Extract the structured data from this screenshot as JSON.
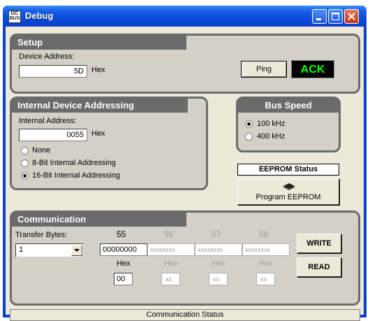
{
  "window": {
    "title": "Debug",
    "icon_text": "I2C BUS"
  },
  "setup": {
    "title": "Setup",
    "device_address_label": "Device Address:",
    "device_address_value": "5D",
    "hex_label": "Hex",
    "ping_label": "Ping",
    "ack_label": "ACK",
    "ack_color": "#00ff00"
  },
  "internal": {
    "title": "Internal Device Addressing",
    "address_label": "Internal Address:",
    "address_value": "0055",
    "hex_label": "Hex",
    "options": [
      "None",
      "8-Bit Internal Addressing",
      "16-Bit Internal Addressing"
    ],
    "selected": "16-Bit Internal Addressing"
  },
  "bus_speed": {
    "title": "Bus Speed",
    "options": [
      "100 kHz",
      "400 kHz"
    ],
    "selected": "100 kHz"
  },
  "eeprom": {
    "status_label": "EEPROM Status",
    "program_label": "Program EEPROM",
    "program_icon": "chip-icon"
  },
  "communication": {
    "title": "Communication",
    "transfer_bytes_label": "Transfer Bytes:",
    "transfer_bytes_value": "1",
    "columns": [
      {
        "number": "55",
        "binary": "00000000",
        "hex_label": "Hex",
        "hex": "00",
        "enabled": true
      },
      {
        "number": "56",
        "binary": "xxxxxxxx",
        "hex_label": "Hex",
        "hex": "xx",
        "enabled": false
      },
      {
        "number": "57",
        "binary": "xxxxxxxx",
        "hex_label": "Hex",
        "hex": "xx",
        "enabled": false
      },
      {
        "number": "58",
        "binary": "xxxxxxxx",
        "hex_label": "Hex",
        "hex": "xx",
        "enabled": false
      }
    ],
    "write_label": "WRITE",
    "read_label": "READ"
  },
  "status": {
    "text": "Communication Status"
  }
}
